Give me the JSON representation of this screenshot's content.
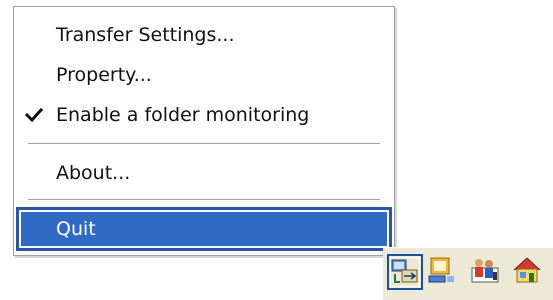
{
  "context_menu": {
    "items": [
      {
        "label": "Transfer Settings...",
        "checked": false
      },
      {
        "label": "Property...",
        "checked": false
      },
      {
        "label": "Enable a folder monitoring",
        "checked": true
      },
      {
        "label": "About...",
        "checked": false
      },
      {
        "label": "Quit",
        "checked": false,
        "highlighted": true
      }
    ]
  },
  "tray": {
    "icons": [
      {
        "name": "transfer-app-tray-icon",
        "active": true
      },
      {
        "name": "network-tray-icon",
        "active": false
      },
      {
        "name": "users-tray-icon",
        "active": false
      },
      {
        "name": "home-network-tray-icon",
        "active": false
      }
    ]
  },
  "colors": {
    "selection_bg": "#316ac5",
    "selection_border": "#2957a6",
    "menu_border": "#a0a0a0",
    "tray_bg": "#ece9d8"
  }
}
